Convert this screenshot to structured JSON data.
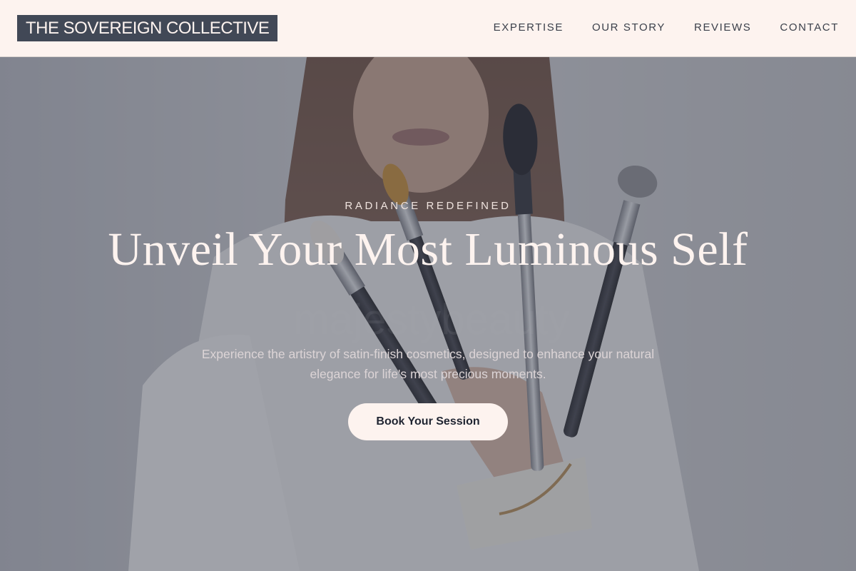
{
  "brand": {
    "name": "THE SOVEREIGN COLLECTIVE"
  },
  "nav": {
    "items": [
      {
        "label": "EXPERTISE"
      },
      {
        "label": "OUR STORY"
      },
      {
        "label": "REVIEWS"
      },
      {
        "label": "CONTACT"
      }
    ]
  },
  "hero": {
    "eyebrow": "RADIANCE REDEFINED",
    "headline": "Unveil Your Most Luminous Self",
    "subtitle": "Experience the artistry of satin-finish cosmetics, designed to enhance your natural elegance for life's most precious moments.",
    "cta_label": "Book Your Session",
    "photo_description_icon": "woman-holding-makeup-brushes-photo",
    "watermark": "majestybeauty"
  },
  "colors": {
    "header_bg": "#fdf3ef",
    "logo_bg": "#414856",
    "nav_text": "#3a3f4a",
    "overlay": "#464a56",
    "cta_bg": "#fdf3ef",
    "cta_text": "#1f2431"
  }
}
